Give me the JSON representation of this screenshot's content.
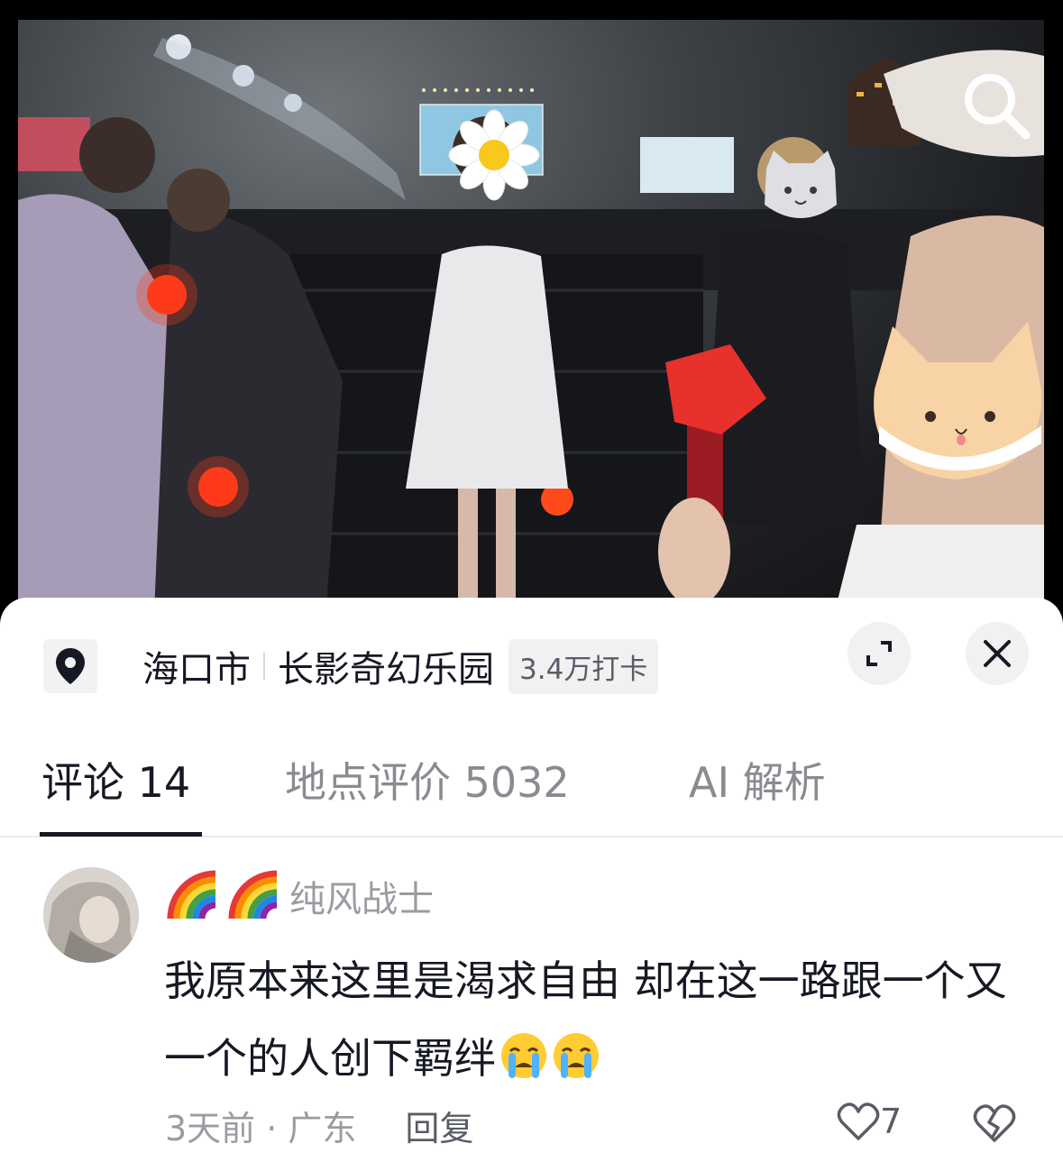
{
  "location": {
    "city": "海口市",
    "place": "长影奇幻乐园",
    "checkins": "3.4万打卡"
  },
  "tabs": [
    {
      "label": "评论 14",
      "active": true
    },
    {
      "label": "地点评价 5032",
      "active": false
    },
    {
      "label": "AI 解析",
      "active": false
    }
  ],
  "comment": {
    "username": "纯风战士",
    "text": "我原本来这里是渴求自由 却在这一路跟一个又一个的人创下羁绊",
    "time_region": "3天前 · 广东",
    "reply_label": "回复",
    "likes": "7"
  },
  "icons": {
    "location": "map-pin-icon",
    "expand": "expand-icon",
    "close": "close-icon",
    "search": "search-icon",
    "like": "heart-icon",
    "dislike": "broken-heart-icon",
    "username_prefix": "rainbow-icon",
    "comment_suffix": "crying-face-icon"
  },
  "colors": {
    "text_primary": "#161823",
    "text_secondary": "#9b9ca2",
    "sheet_bg": "#ffffff"
  }
}
